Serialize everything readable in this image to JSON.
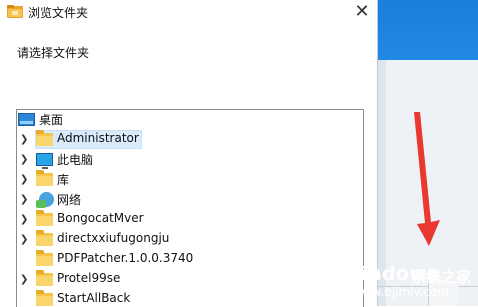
{
  "dialog": {
    "title": "浏览文件夹",
    "instruction": "请选择文件夹"
  },
  "tree": {
    "items": [
      {
        "label": "桌面",
        "icon": "desktop-icon",
        "expander": false,
        "selected": false
      },
      {
        "label": "Administrator",
        "icon": "user-folder-icon",
        "expander": true,
        "selected": true
      },
      {
        "label": "此电脑",
        "icon": "computer-icon",
        "expander": true,
        "selected": false
      },
      {
        "label": "库",
        "icon": "library-folder-icon",
        "expander": true,
        "selected": false
      },
      {
        "label": "网络",
        "icon": "network-icon",
        "expander": true,
        "selected": false
      },
      {
        "label": "BongocatMver",
        "icon": "folder-icon",
        "expander": true,
        "selected": false
      },
      {
        "label": "directxxiufugongju",
        "icon": "folder-icon",
        "expander": true,
        "selected": false
      },
      {
        "label": "PDFPatcher.1.0.0.3740",
        "icon": "folder-icon",
        "expander": false,
        "selected": false
      },
      {
        "label": "Protel99se",
        "icon": "folder-icon",
        "expander": true,
        "selected": false
      },
      {
        "label": "StartAllBack",
        "icon": "folder-icon",
        "expander": false,
        "selected": false
      }
    ]
  },
  "watermark": {
    "brand": "Windows",
    "subtitle": "系统之家",
    "url": "www.bjjmlv.com"
  },
  "colors": {
    "selection": "#d9ebfb",
    "folder": "#f3c54b",
    "arrow": "#e8382f",
    "desktop_blue": "#1a7fdc"
  }
}
